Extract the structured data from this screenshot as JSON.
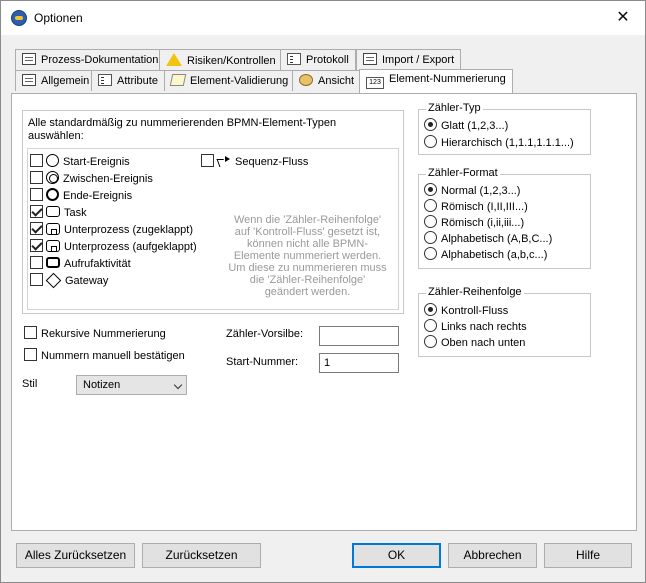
{
  "window": {
    "title": "Optionen"
  },
  "tabs_row1": [
    {
      "label": "Prozess-Dokumentation",
      "icon": "document-icon"
    },
    {
      "label": "Risiken/Kontrollen",
      "icon": "warning-icon"
    },
    {
      "label": "Protokoll",
      "icon": "list-icon"
    },
    {
      "label": "Import / Export",
      "icon": "import-export-icon"
    }
  ],
  "tabs_row2": [
    {
      "label": "Allgemein",
      "icon": "document-icon"
    },
    {
      "label": "Attribute",
      "icon": "list-icon"
    },
    {
      "label": "Element-Validierung",
      "icon": "edit-icon"
    },
    {
      "label": "Ansicht",
      "icon": "palette-icon"
    },
    {
      "label": "Element-Nummerierung",
      "icon": "numbering-icon",
      "active": true
    }
  ],
  "element_types": {
    "caption": "Alle standardmäßig zu nummerierenden BPMN-Element-Typen auswählen:",
    "caption_line1": "Alle standardmäßig zu nummerierenden BPMN-Element-Typen",
    "caption_line2": "auswählen:",
    "items": [
      {
        "label": "Start-Ereignis",
        "checked": false
      },
      {
        "label": "Zwischen-Ereignis",
        "checked": false
      },
      {
        "label": "Ende-Ereignis",
        "checked": false
      },
      {
        "label": "Task",
        "checked": true
      },
      {
        "label": "Unterprozess (zugeklappt)",
        "checked": true
      },
      {
        "label": "Unterprozess (aufgeklappt)",
        "checked": true
      },
      {
        "label": "Aufrufaktivität",
        "checked": false
      },
      {
        "label": "Gateway",
        "checked": false
      }
    ],
    "flow_item": {
      "label": "Sequenz-Fluss",
      "checked": false
    },
    "hint_lines": [
      "Wenn die 'Zähler-Reihenfolge'",
      "auf 'Kontroll-Fluss' gesetzt ist,",
      "können nicht alle BPMN-",
      "Elemente nummeriert werden.",
      "Um diese zu nummerieren muss",
      "die 'Zähler-Reihenfolge'",
      "geändert werden."
    ]
  },
  "options": {
    "recursive": {
      "label": "Rekursive Nummerierung",
      "checked": false
    },
    "manual_confirm": {
      "label": "Nummern manuell bestätigen",
      "checked": false
    },
    "style_label": "Stil",
    "style_value": "Notizen",
    "prefix_label": "Zähler-Vorsilbe:",
    "prefix_value": "",
    "start_label": "Start-Nummer:",
    "start_value": "1"
  },
  "counter_type": {
    "title": "Zähler-Typ",
    "options": [
      {
        "label": "Glatt (1,2,3...)",
        "selected": true
      },
      {
        "label": "Hierarchisch (1,1.1,1.1.1...)",
        "selected": false
      }
    ]
  },
  "counter_format": {
    "title": "Zähler-Format",
    "options": [
      {
        "label": "Normal (1,2,3...)",
        "selected": true
      },
      {
        "label": "Römisch (I,II,III...)",
        "selected": false
      },
      {
        "label": "Römisch (i,ii,iii...)",
        "selected": false
      },
      {
        "label": "Alphabetisch (A,B,C...)",
        "selected": false
      },
      {
        "label": "Alphabetisch (a,b,c...)",
        "selected": false
      }
    ]
  },
  "counter_order": {
    "title": "Zähler-Reihenfolge",
    "options": [
      {
        "label": "Kontroll-Fluss",
        "selected": true
      },
      {
        "label": "Links nach rechts",
        "selected": false
      },
      {
        "label": "Oben nach unten",
        "selected": false
      }
    ]
  },
  "buttons": {
    "reset_all": "Alles Zurücksetzen",
    "reset": "Zurücksetzen",
    "ok": "OK",
    "cancel": "Abbrechen",
    "help": "Hilfe"
  },
  "colors": {
    "accent": "#0078d7",
    "hint_text": "#9a9a9a"
  }
}
